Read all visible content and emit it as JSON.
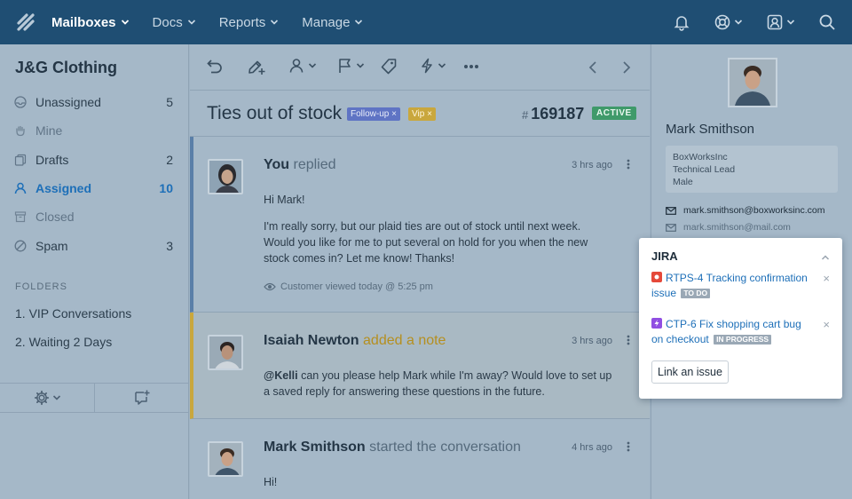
{
  "nav": {
    "items": [
      {
        "label": "Mailboxes",
        "active": true
      },
      {
        "label": "Docs",
        "active": false
      },
      {
        "label": "Reports",
        "active": false
      },
      {
        "label": "Manage",
        "active": false
      }
    ],
    "right_icons": [
      "bell-icon",
      "help-lifebuoy-icon",
      "user-account-icon",
      "search-icon"
    ]
  },
  "sidebar": {
    "mailbox_name": "J&G Clothing",
    "folders": [
      {
        "label": "Unassigned",
        "count": "5",
        "icon": "inbox-icon"
      },
      {
        "label": "Mine",
        "count": "",
        "icon": "hand-icon"
      },
      {
        "label": "Drafts",
        "count": "2",
        "icon": "drafts-icon"
      },
      {
        "label": "Assigned",
        "count": "10",
        "icon": "user-icon"
      },
      {
        "label": "Closed",
        "count": "",
        "icon": "archive-icon"
      },
      {
        "label": "Spam",
        "count": "3",
        "icon": "spam-icon"
      }
    ],
    "folders_heading": "FOLDERS",
    "custom_folders": [
      "1. VIP Conversations",
      "2. Waiting 2 Days"
    ]
  },
  "conversation": {
    "subject": "Ties out of stock",
    "tags": [
      {
        "label": "Follow-up",
        "color": "#5f74c4"
      },
      {
        "label": "Vip",
        "color": "#c9a73d"
      }
    ],
    "tag_remove": "×",
    "number_hash": "#",
    "number": "169187",
    "status": "ACTIVE",
    "threads": [
      {
        "author": "You",
        "action": "replied",
        "time": "3 hrs ago",
        "paragraphs": [
          "Hi Mark!",
          "I'm really sorry, but our plaid ties are out of stock until next week. Would you like for me to put several on hold for you when the new stock comes in? Let me know! Thanks!"
        ],
        "viewed": "Customer viewed today @ 5:25 pm"
      },
      {
        "author": "Isaiah Newton",
        "action": "added a note",
        "time": "3 hrs ago",
        "mention": "@Kelli",
        "text": " can you please help Mark while I'm away? Would love to set up a saved reply for answering these questions in the future."
      },
      {
        "author": "Mark Smithson",
        "action": "started the conversation",
        "time": "4 hrs ago",
        "text": "Hi!"
      }
    ]
  },
  "customer": {
    "name": "Mark Smithson",
    "company": "BoxWorksInc",
    "title": "Technical Lead",
    "gender": "Male",
    "emails": [
      "mark.smithson@boxworksinc.com",
      "mark.smithson@mail.com"
    ]
  },
  "jira": {
    "title": "JIRA",
    "issues": [
      {
        "key_title": "RTPS-4 Tracking confirmation issue",
        "status": "TO DO",
        "icon_color": "#e5493a",
        "icon": "bug-icon"
      },
      {
        "key_title": "CTP-6 Fix shopping cart bug on checkout",
        "status": "IN PROGRESS",
        "icon_color": "#904ee2",
        "icon": "epic-icon"
      }
    ],
    "remove": "×",
    "link_button": "Link an issue"
  }
}
